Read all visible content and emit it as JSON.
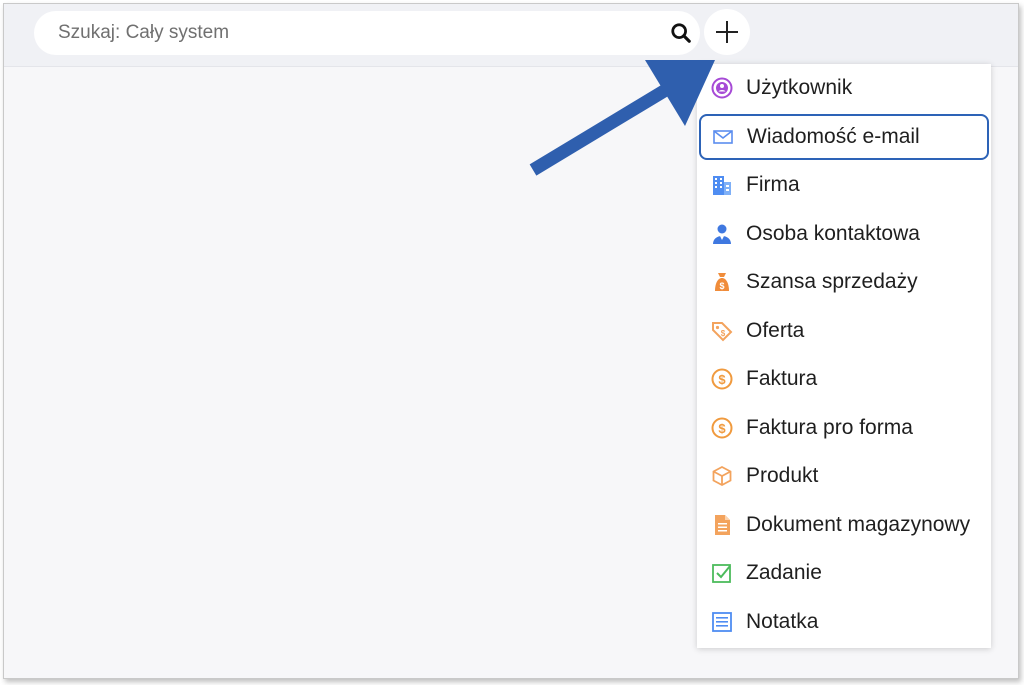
{
  "search": {
    "placeholder": "Szukaj: Cały system",
    "icon": "search-icon"
  },
  "add_button": {
    "icon": "plus-icon"
  },
  "menu": {
    "highlighted_index": 1,
    "items": [
      {
        "label": "Użytkownik",
        "icon": "user-circle-icon",
        "color": "#a64ad6"
      },
      {
        "label": "Wiadomość e-mail",
        "icon": "envelope-icon",
        "color": "#5b8def"
      },
      {
        "label": "Firma",
        "icon": "building-icon",
        "color": "#4f8df2"
      },
      {
        "label": "Osoba kontaktowa",
        "icon": "contact-person-icon",
        "color": "#3f78e0"
      },
      {
        "label": "Szansa sprzedaży",
        "icon": "money-bag-icon",
        "color": "#f08c3a"
      },
      {
        "label": "Oferta",
        "icon": "tag-icon",
        "color": "#f3a35d"
      },
      {
        "label": "Faktura",
        "icon": "dollar-circle-icon",
        "color": "#f09a3e"
      },
      {
        "label": "Faktura pro forma",
        "icon": "dollar-circle-icon",
        "color": "#f09a3e"
      },
      {
        "label": "Produkt",
        "icon": "box-icon",
        "color": "#f3a35d"
      },
      {
        "label": "Dokument magazynowy",
        "icon": "document-icon",
        "color": "#f3a35d"
      },
      {
        "label": "Zadanie",
        "icon": "checkbox-icon",
        "color": "#4cbb5c"
      },
      {
        "label": "Notatka",
        "icon": "note-icon",
        "color": "#4f8df2"
      }
    ]
  },
  "colors": {
    "arrow": "#2f5fae",
    "highlight_border": "#2d63b7"
  }
}
